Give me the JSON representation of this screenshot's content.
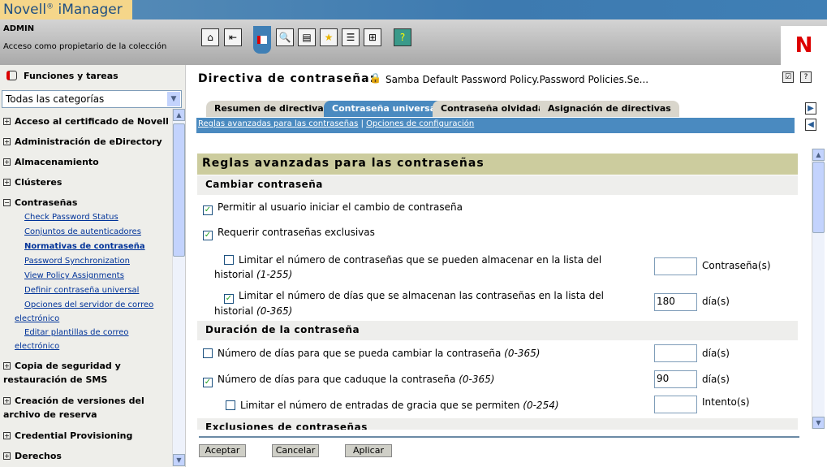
{
  "app": {
    "brand": "Novell",
    "brand_mark": "®",
    "product": "iManager",
    "user": "ADMIN",
    "access": "Acceso como propietario de la colección",
    "logo": "N"
  },
  "toolbar": [
    "home-icon",
    "exit-icon",
    "roles-tasks-icon",
    "view-objects-icon",
    "configure-icon",
    "favorites-icon",
    "preferences-icon",
    "network-icon",
    "help-icon"
  ],
  "sidebar": {
    "title": "Funciones y tareas",
    "category": "Todas las categorías",
    "groups": [
      {
        "label": "Acceso al certificado de Novell",
        "expanded": false
      },
      {
        "label": "Administración de eDirectory",
        "expanded": false
      },
      {
        "label": "Almacenamiento",
        "expanded": false
      },
      {
        "label": "Clústeres",
        "expanded": false
      },
      {
        "label": "Contraseñas",
        "expanded": true
      },
      {
        "label": "Copia de seguridad y restauración de SMS",
        "expanded": false
      },
      {
        "label": "Creación de versiones del archivo de reserva",
        "expanded": false
      },
      {
        "label": "Credential Provisioning",
        "expanded": false
      },
      {
        "label": "Derechos",
        "expanded": false
      }
    ],
    "links": [
      "Check Password Status",
      "Conjuntos de autenticadores",
      "Normativas de contraseña",
      "Password Synchronization",
      "View Policy Assignments",
      "Definir contraseña universal",
      "Opciones del servidor de correo electrónico",
      "Editar plantillas de correo electrónico"
    ],
    "active_link": "Normativas de contraseña"
  },
  "main": {
    "title": "Directiva de contraseña:",
    "object": "Samba Default Password Policy.Password Policies.Se...",
    "tabs": [
      "Resumen de directivas",
      "Contraseña universal",
      "Contraseña olvidada",
      "Asignación de directivas"
    ],
    "active_tab": "Contraseña universal",
    "subtabs": [
      "Reglas avanzadas para las contraseñas",
      "Opciones de configuración"
    ],
    "sep": "|",
    "panel_title": "Reglas avanzadas para las contraseñas",
    "sections": [
      "Cambiar contraseña",
      "Duración de la contraseña",
      "Exclusiones de contraseñas"
    ],
    "rows": [
      {
        "label": "Permitir al usuario iniciar el cambio de contraseña",
        "checked": true
      },
      {
        "label": "Requerir contraseñas exclusivas",
        "checked": true
      },
      {
        "label": "Limitar el número de contraseñas que se pueden almacenar en la lista del historial",
        "range": "(1-255)",
        "checked": false,
        "value": "",
        "unit": "Contraseña(s)"
      },
      {
        "label": "Limitar el número de días que se almacenan las contraseñas en la lista del historial",
        "range": "(0-365)",
        "checked": true,
        "value": "180",
        "unit": "día(s)"
      },
      {
        "label": "Número de días para que se pueda cambiar la contraseña",
        "range": "(0-365)",
        "checked": false,
        "value": "",
        "unit": "día(s)"
      },
      {
        "label": "Número de días para que caduque la contraseña",
        "range": "(0-365)",
        "checked": true,
        "value": "90",
        "unit": "día(s)"
      },
      {
        "label": "Limitar el número de entradas de gracia que se permiten",
        "range": "(0-254)",
        "checked": false,
        "value": "",
        "unit": "Intento(s)"
      }
    ],
    "buttons": {
      "ok": "Aceptar",
      "cancel": "Cancelar",
      "apply": "Aplicar"
    }
  }
}
